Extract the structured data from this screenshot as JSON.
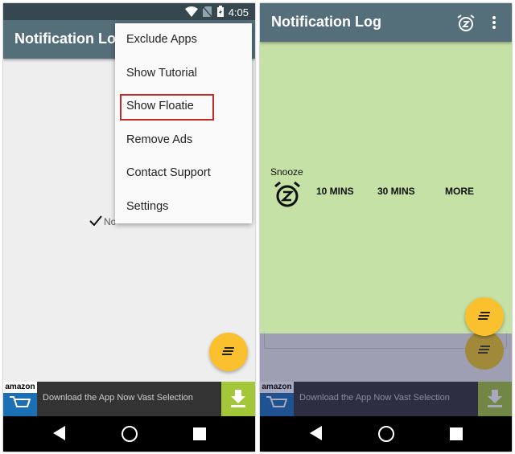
{
  "left": {
    "status": {
      "time": "4:05"
    },
    "toolbar": {
      "title": "Notification Log"
    },
    "content": {
      "partial_label": "No"
    },
    "menu": {
      "items": [
        "Exclude Apps",
        "Show Tutorial",
        "Show Floatie",
        "Remove Ads",
        "Contact Support",
        "Settings"
      ],
      "highlighted": "Show Floatie"
    },
    "ad": {
      "brand": "amazon",
      "text": "Download the App Now Vast Selection"
    }
  },
  "right": {
    "toolbar": {
      "title": "Notification Log"
    },
    "snooze": {
      "label": "Snooze",
      "options": [
        "10 MINS",
        "30 MINS",
        "MORE"
      ]
    },
    "ad": {
      "brand": "amazon",
      "text": "Download the App Now Vast Selection"
    }
  },
  "colors": {
    "toolbar": "#546e7a",
    "status": "#37474f",
    "fab": "#fbc02d",
    "snooze_bg": "#c5e1a5",
    "ad_download": "#a4c639",
    "highlight": "#c62828"
  }
}
